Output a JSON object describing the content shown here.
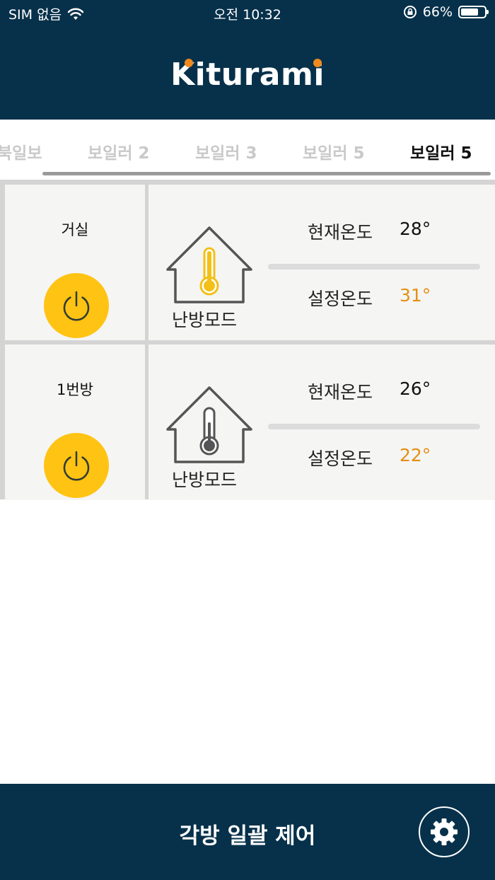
{
  "status_bar": {
    "carrier": "SIM 없음",
    "time": "오전 10:32",
    "battery": "66%",
    "battery_level": 0.66
  },
  "header": {
    "logo_text": "Kiturami",
    "logo_dot_color": "#f08a1c"
  },
  "tabs": [
    {
      "label": "북일보",
      "active": false
    },
    {
      "label": "보일러 2",
      "active": false
    },
    {
      "label": "보일러 3",
      "active": false
    },
    {
      "label": "보일러 5",
      "active": false
    },
    {
      "label": "보일러 5",
      "active": true
    }
  ],
  "rooms": [
    {
      "name": "거실",
      "mode": "난방모드",
      "current_label": "현재온도",
      "current_temp": "28°",
      "set_label": "설정온도",
      "set_temp": "31°",
      "thermometer_color": "#f3c019"
    },
    {
      "name": "1번방",
      "mode": "난방모드",
      "current_label": "현재온도",
      "current_temp": "26°",
      "set_label": "설정온도",
      "set_temp": "22°",
      "thermometer_color": "#555555"
    }
  ],
  "footer": {
    "title": "각방 일괄 제어",
    "settings_icon": "gear-icon"
  },
  "colors": {
    "navy": "#07314a",
    "power_yellow": "#ffc313",
    "set_temp_orange": "#e58f12"
  }
}
